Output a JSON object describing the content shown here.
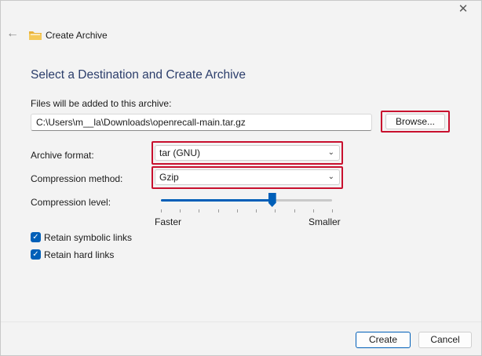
{
  "window": {
    "title": "Create Archive",
    "close_glyph": "✕",
    "back_glyph": "←",
    "folder_icon": "folder-icon"
  },
  "dialog": {
    "heading": "Select a Destination and Create Archive",
    "files_label": "Files will be added to this archive:",
    "path_value": "C:\\Users\\m__la\\Downloads\\openrecall-main.tar.gz",
    "browse_label": "Browse...",
    "archive_format_label": "Archive format:",
    "archive_format_value": "tar (GNU)",
    "compression_method_label": "Compression method:",
    "compression_method_value": "Gzip",
    "compression_level_label": "Compression level:",
    "compression_level_fraction": 0.65,
    "slider_min_label": "Faster",
    "slider_max_label": "Smaller",
    "retain_symbolic_label": "Retain symbolic links",
    "retain_symbolic_checked": true,
    "retain_hard_label": "Retain hard links",
    "retain_hard_checked": true
  },
  "footer": {
    "create_label": "Create",
    "cancel_label": "Cancel"
  },
  "colors": {
    "accent": "#005fb8",
    "highlight": "#c8102e",
    "heading": "#2c3e6b"
  }
}
